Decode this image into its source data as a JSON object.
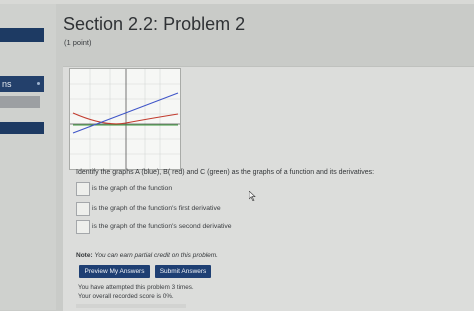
{
  "sidebar": {
    "item_label": "ns"
  },
  "problem": {
    "title": "Section 2.2: Problem 2",
    "points": "(1 point)"
  },
  "graph": {
    "curves": [
      {
        "name": "A",
        "color": "#3f55c8"
      },
      {
        "name": "B",
        "color": "#c23b2e"
      },
      {
        "name": "C",
        "color": "#3a9a3a"
      }
    ]
  },
  "question": "Identify the graphs A (blue), B( red) and C (green) as the graphs of a function and its derivatives:",
  "answers": [
    {
      "value": "",
      "label": "is the graph of the function"
    },
    {
      "value": "",
      "label": "is the graph of the function's first derivative"
    },
    {
      "value": "",
      "label": "is the graph of the function's second derivative"
    }
  ],
  "note": {
    "prefix": "Note:",
    "text": "You can earn partial credit on this problem."
  },
  "buttons": {
    "preview": "Preview My Answers",
    "submit": "Submit Answers"
  },
  "status": {
    "attempts": "You have attempted this problem 3 times.",
    "score": "Your overall recorded score is 0%."
  },
  "colors": {
    "button": "#1e3f73",
    "sidebar_accent": "#1d3a63"
  }
}
